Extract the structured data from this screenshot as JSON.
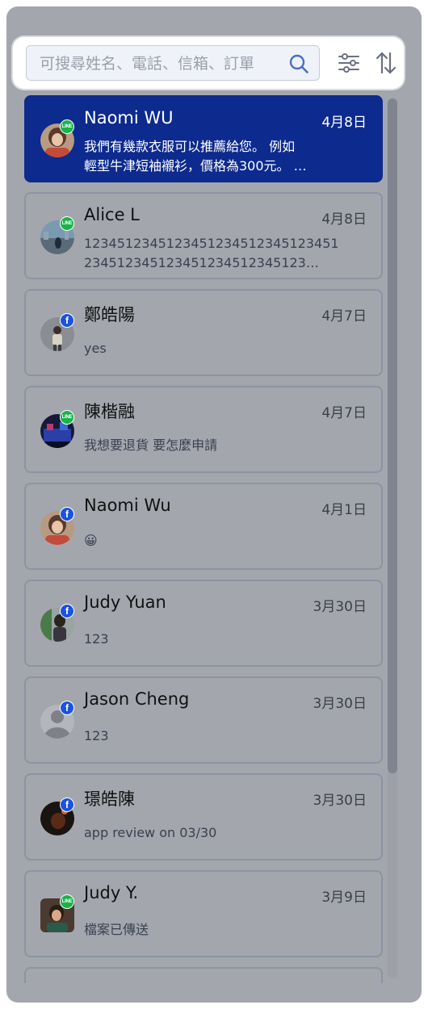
{
  "search": {
    "placeholder": "可搜尋姓名、電話、信箱、訂單",
    "value": ""
  },
  "icons": {
    "search": "search-icon",
    "filter": "filter-sliders-icon",
    "sort": "sort-arrows-icon"
  },
  "colors": {
    "active_background": "#0d2a8e",
    "facebook_badge": "#1a53e0",
    "line_badge": "#19b34a",
    "panel_background": "#a3a6ad"
  },
  "conversations": [
    {
      "name": "Naomi WU",
      "date": "4月8日",
      "message": "我們有幾款衣服可以推薦給您。 例如\n輕型牛津短袖襯衫，價格為300元。 …",
      "channel": "LINE",
      "active": true
    },
    {
      "name": "Alice L",
      "date": "4月8日",
      "message": "1234512345123451234512345123451234512345123451234512345123…",
      "channel": "LINE",
      "active": false
    },
    {
      "name": "鄭皓陽",
      "date": "4月7日",
      "message": "yes",
      "channel": "f",
      "active": false
    },
    {
      "name": "陳楷融",
      "date": "4月7日",
      "message": "我想要退貨 要怎麼申請",
      "channel": "LINE",
      "active": false
    },
    {
      "name": "Naomi Wu",
      "date": "4月1日",
      "message": "😀",
      "channel": "f",
      "active": false
    },
    {
      "name": "Judy Yuan",
      "date": "3月30日",
      "message": "123",
      "channel": "f",
      "active": false
    },
    {
      "name": "Jason Cheng",
      "date": "3月30日",
      "message": "123",
      "channel": "f",
      "active": false
    },
    {
      "name": "璟皓陳",
      "date": "3月30日",
      "message": "app review on 03/30",
      "channel": "f",
      "active": false
    },
    {
      "name": "Judy Y.",
      "date": "3月9日",
      "message": "檔案已傳送",
      "channel": "LINE",
      "active": false
    }
  ]
}
